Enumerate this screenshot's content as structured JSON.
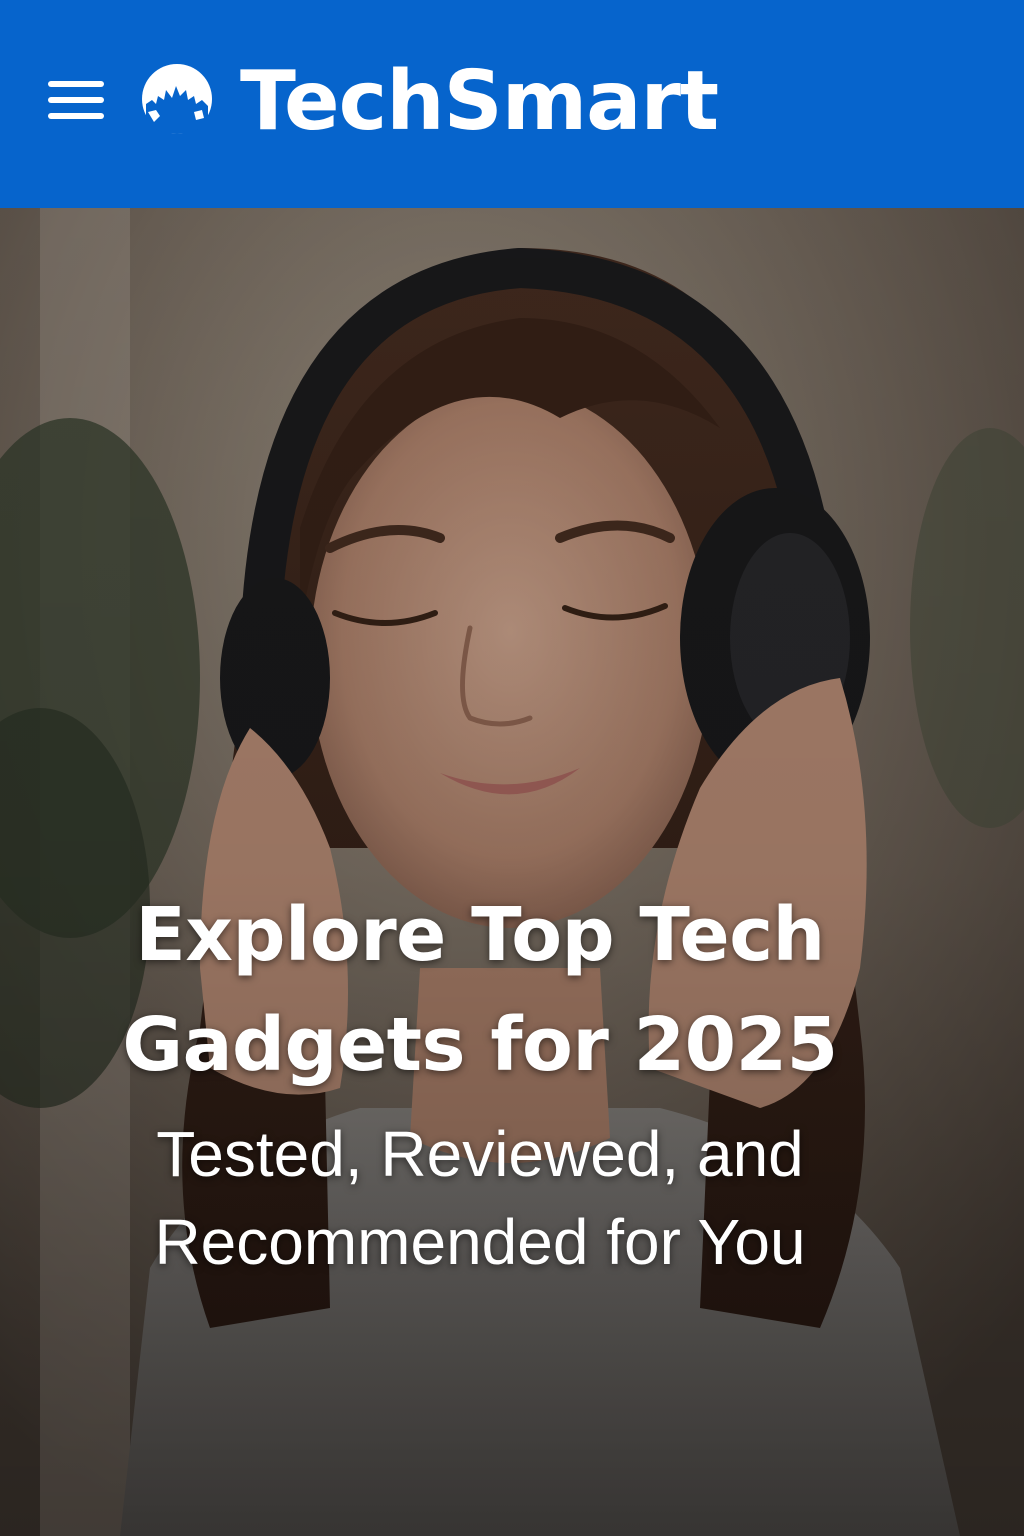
{
  "header": {
    "brand_name": "TechSmart",
    "background_color": "#0664cc",
    "menu_icon": "hamburger-menu-icon",
    "logo_icon": "globe-icon"
  },
  "hero": {
    "title": "Explore Top Tech Gadgets for 2025",
    "subtitle": "Tested, Reviewed, and Recommended for You",
    "text_color": "#ffffff"
  }
}
